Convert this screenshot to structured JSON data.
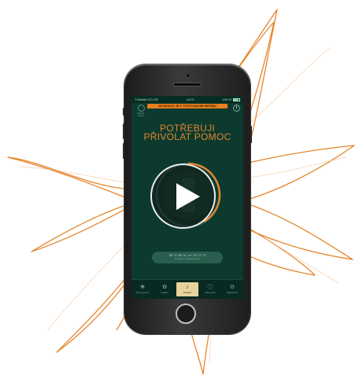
{
  "status_bar": {
    "carrier": "T-Mobile CZ",
    "network": "LTE",
    "time": "14:07",
    "battery": "100 %"
  },
  "banner": {
    "text": "APLIKACE JE V TESTOVACÍM REŽIMU"
  },
  "top_left": {
    "label": "Rychlý hovor"
  },
  "info_button": {
    "glyph": "i"
  },
  "heading": {
    "line1": "POTŘEBUJI",
    "line2": "PŘIVOLAT POMOC"
  },
  "location": {
    "coordinates": "50° 5' 48\" N, 14° 25' 17\" E",
    "note": "Poslední známá poloha"
  },
  "tabs": [
    {
      "label": "První pomoc",
      "icon": "first-aid-icon"
    },
    {
      "label": "Lokální",
      "icon": "location-icon"
    },
    {
      "label": "Tlačítko",
      "icon": "bell-icon",
      "active": true
    },
    {
      "label": "Informace",
      "icon": "info-icon"
    },
    {
      "label": "Nastavení",
      "icon": "gear-icon"
    }
  ],
  "colors": {
    "accent": "#e5852b",
    "screen_bg": "#0c3a2f",
    "active_tab": "#e9d39c"
  }
}
